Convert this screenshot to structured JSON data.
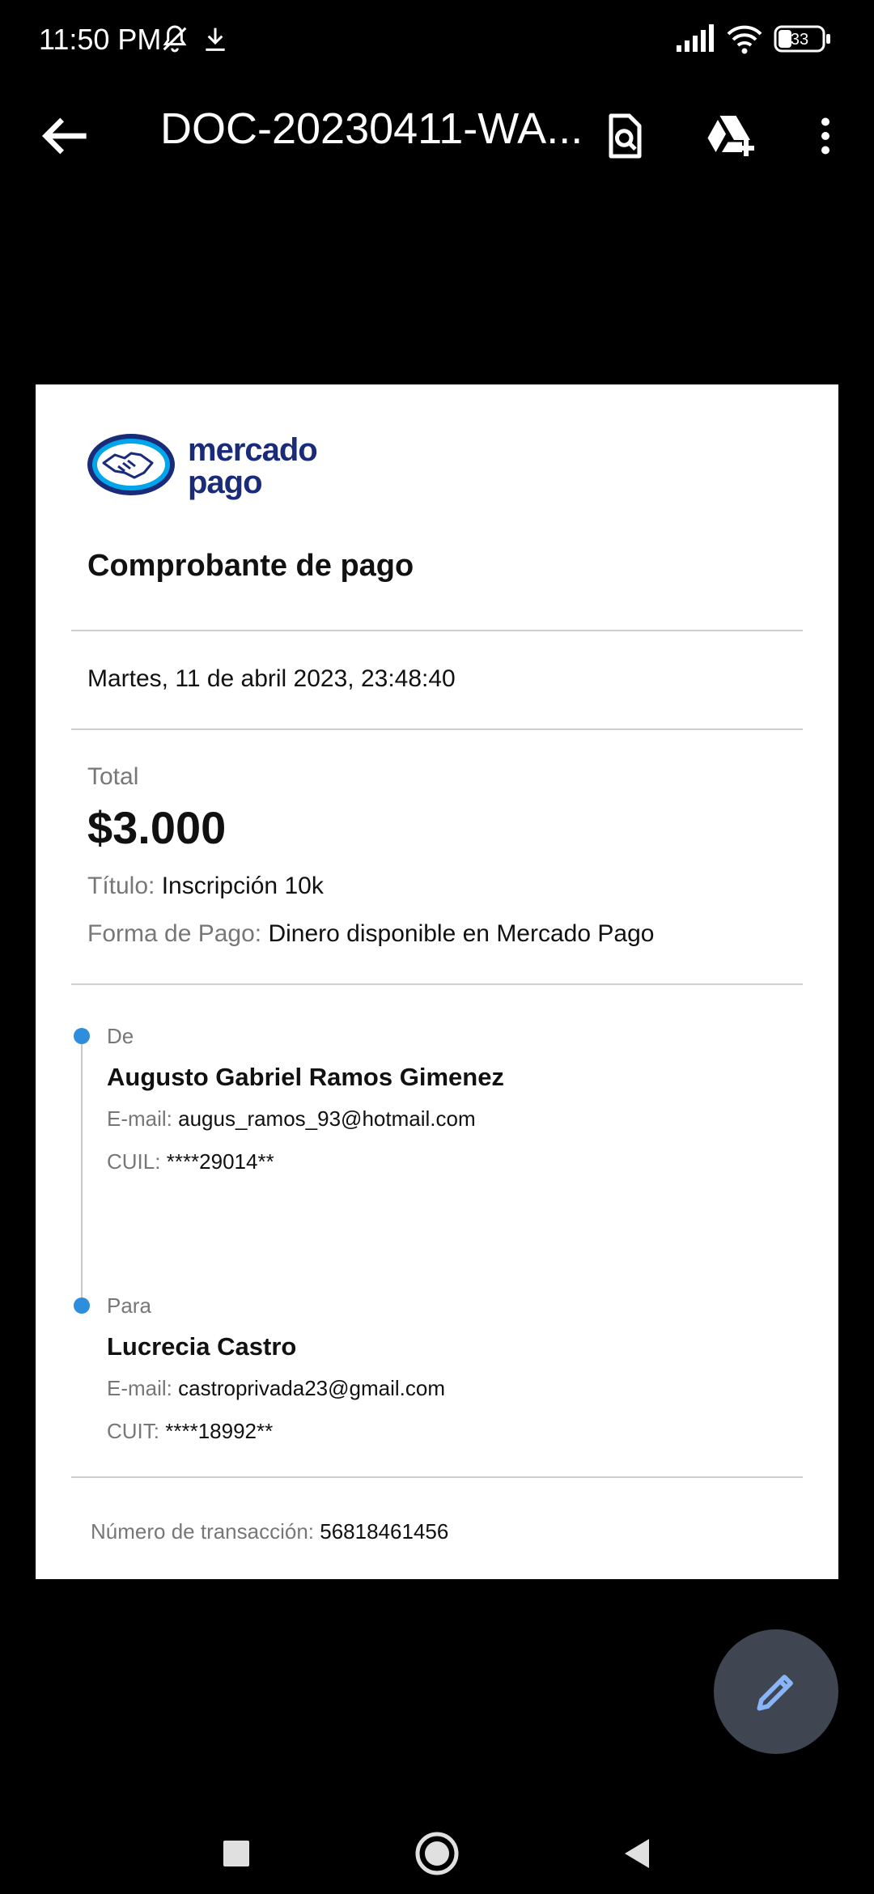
{
  "status_bar": {
    "time": "11:50 PM",
    "battery": "33",
    "icons": [
      "muted-bell-icon",
      "download-icon",
      "signal-icon",
      "wifi-icon",
      "battery-icon"
    ]
  },
  "app_bar": {
    "title": "DOC-20230411-WA...",
    "icons": [
      "back-arrow-icon",
      "search-document-icon",
      "drive-add-icon",
      "more-vert-icon"
    ]
  },
  "document": {
    "logo_line1": "mercado",
    "logo_line2": "pago",
    "heading": "Comprobante de pago",
    "date": "Martes, 11 de abril 2023, 23:48:40",
    "total_label": "Total",
    "total_amount": "$3.000",
    "titulo_label": "Título:",
    "titulo_value": "Inscripción 10k",
    "forma_label": "Forma de Pago:",
    "forma_value": "Dinero disponible en Mercado Pago",
    "from": {
      "label": "De",
      "name": "Augusto Gabriel Ramos Gimenez",
      "email_label": "E-mail:",
      "email": "augus_ramos_93@hotmail.com",
      "id_label": "CUIL:",
      "id": "****29014**"
    },
    "to": {
      "label": "Para",
      "name": "Lucrecia Castro",
      "email_label": "E-mail:",
      "email": "castroprivada23@gmail.com",
      "id_label": "CUIT:",
      "id": "****18992**"
    },
    "transaction_label": "Número de transacción:",
    "transaction_number": "56818461456"
  },
  "colors": {
    "accent_blue": "#2e8ddd",
    "brand_navy": "#1a2b7a",
    "fab_bg": "#3f4651",
    "fab_icon": "#8ab4f8"
  }
}
